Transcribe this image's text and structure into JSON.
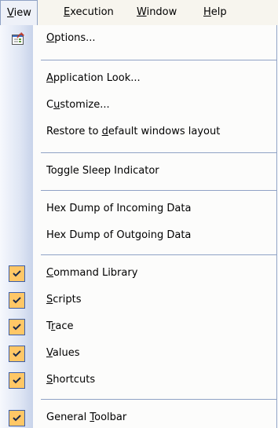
{
  "menubar": {
    "items": [
      {
        "label": "View",
        "mnemonic": "V",
        "active": true
      },
      {
        "label": "Execution",
        "mnemonic": "E",
        "active": false
      },
      {
        "label": "Window",
        "mnemonic": "W",
        "active": false
      },
      {
        "label": "Help",
        "mnemonic": "H",
        "active": false
      }
    ]
  },
  "view_menu": {
    "items": [
      {
        "label": "Options...",
        "mnemonic": "O",
        "checked": false,
        "icon": "options-icon"
      },
      {
        "label": "Application Look...",
        "mnemonic": "A",
        "checked": false
      },
      {
        "label": "Customize...",
        "mnemonic": "u",
        "checked": false
      },
      {
        "label": "Restore to default windows layout",
        "mnemonic": "d",
        "checked": false
      },
      {
        "label": "Toggle Sleep Indicator",
        "checked": false
      },
      {
        "label": "Hex Dump of Incoming Data",
        "checked": false
      },
      {
        "label": "Hex Dump of Outgoing Data",
        "checked": false
      },
      {
        "label": "Command Library",
        "mnemonic": "C",
        "checked": true
      },
      {
        "label": "Scripts",
        "mnemonic": "S",
        "checked": true
      },
      {
        "label": "Trace",
        "mnemonic": "r",
        "checked": true
      },
      {
        "label": "Values",
        "mnemonic": "V",
        "checked": true
      },
      {
        "label": "Shortcuts",
        "mnemonic": "S",
        "checked": true
      },
      {
        "label": "General Toolbar",
        "mnemonic": "T",
        "checked": true
      }
    ]
  },
  "colors": {
    "highlight_border": "#8fa2c5",
    "check_fill": "#ffc766",
    "check_border": "#3b5da7"
  }
}
